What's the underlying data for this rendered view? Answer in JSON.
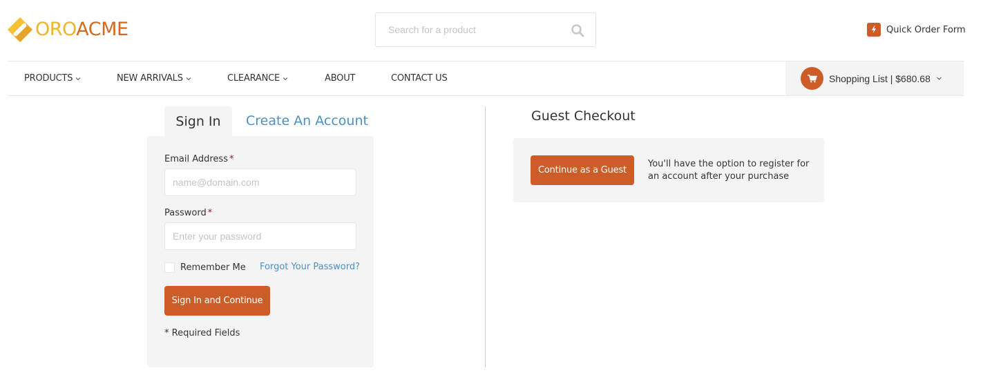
{
  "header": {
    "logo": {
      "part1": "ORO",
      "part2": "ACME",
      "icon": "oroacme-logo-icon"
    },
    "search": {
      "placeholder": "Search for a product",
      "value": "",
      "icon": "search-icon"
    },
    "quick_order": {
      "label": "Quick Order Form",
      "icon": "lightning-icon"
    }
  },
  "nav": {
    "items": [
      {
        "label": "PRODUCTS",
        "has_dropdown": true
      },
      {
        "label": "NEW ARRIVALS",
        "has_dropdown": true
      },
      {
        "label": "CLEARANCE",
        "has_dropdown": true
      },
      {
        "label": "ABOUT",
        "has_dropdown": false
      },
      {
        "label": "CONTACT US",
        "has_dropdown": false
      }
    ],
    "shopping_list": {
      "label": "Shopping List | $680.68",
      "icon": "cart-icon"
    }
  },
  "signin": {
    "tabs": [
      {
        "label": "Sign In",
        "active": true
      },
      {
        "label": "Create An Account",
        "active": false
      }
    ],
    "email": {
      "label": "Email Address",
      "required_mark": "*",
      "placeholder": "name@domain.com",
      "value": ""
    },
    "password": {
      "label": "Password",
      "required_mark": "*",
      "placeholder": "Enter your password",
      "value": ""
    },
    "remember_me": {
      "label": "Remember Me",
      "checked": false
    },
    "forgot_link": "Forgot Your Password?",
    "submit_label": "Sign In and Continue",
    "required_note": "* Required Fields"
  },
  "guest": {
    "title": "Guest Checkout",
    "button_label": "Continue as a Guest",
    "note": "You'll have the option to register for an account after your purchase"
  },
  "colors": {
    "accent": "#cc5c28",
    "link": "#4a90c2",
    "logo_yellow": "#f0b429",
    "logo_orange": "#d2691e",
    "panel_bg": "#f4f4f4"
  }
}
